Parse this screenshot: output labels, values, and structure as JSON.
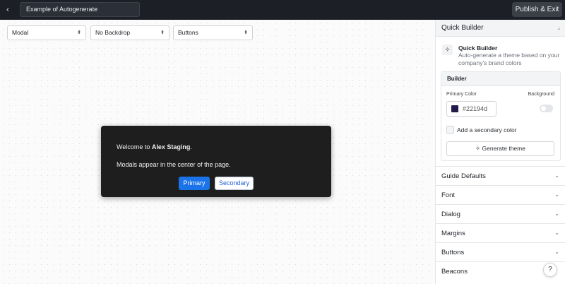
{
  "topbar": {
    "back_icon": "chevron-left-icon",
    "title_value": "Example of Autogenerate",
    "publish_label": "Publish & Exit"
  },
  "canvas": {
    "selects": [
      {
        "value": "Modal"
      },
      {
        "value": "No Backdrop"
      },
      {
        "value": "Buttons"
      }
    ],
    "modal": {
      "welcome_prefix": "Welcome to ",
      "welcome_name": "Alex Staging",
      "welcome_suffix": ".",
      "body": "Modals appear in the center of the page.",
      "primary_label": "Primary",
      "secondary_label": "Secondary"
    }
  },
  "panel": {
    "quick_builder_header": "Quick Builder",
    "quick_builder_title": "Quick Builder",
    "quick_builder_desc": "Auto-generate a theme based on your company's brand colors",
    "builder": {
      "title": "Builder",
      "primary_color_label": "Primary Color",
      "background_label": "Background",
      "primary_color_value": "#22194d",
      "swatch_color": "#22194d",
      "secondary_label": "Add a secondary color",
      "generate_label": "Generate theme"
    },
    "sections": [
      "Guide Defaults",
      "Font",
      "Dialog",
      "Margins",
      "Buttons",
      "Beacons"
    ]
  },
  "help_label": "?",
  "colors": {
    "topbar": "#1c1f26",
    "primary_button": "#1a73e8",
    "modal_bg": "#1e1e1e"
  }
}
